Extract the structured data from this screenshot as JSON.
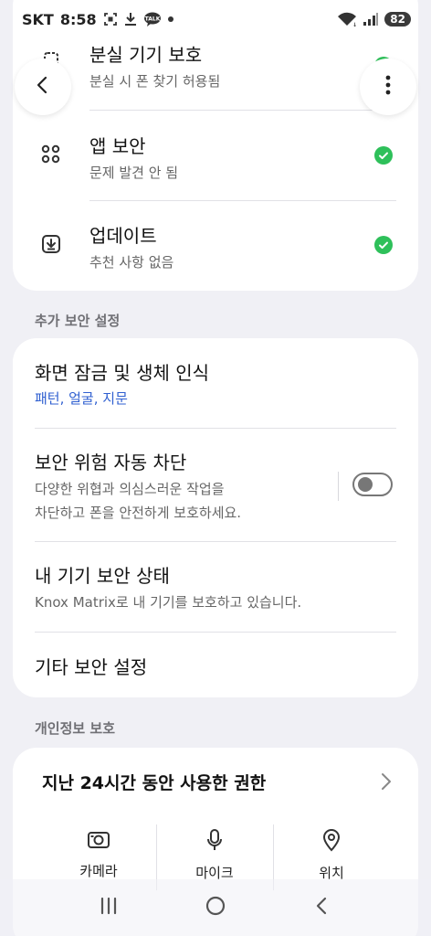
{
  "status_bar": {
    "carrier": "SKT",
    "time": "8:58",
    "battery": "82"
  },
  "card_top": {
    "rows": [
      {
        "title": "분실 기기 보호",
        "subtitle": "분실 시 폰 찾기 허용됨",
        "icon": "lost-device-icon"
      },
      {
        "title": "앱 보안",
        "subtitle": "문제 발견 안 됨",
        "icon": "app-security-icon"
      },
      {
        "title": "업데이트",
        "subtitle": "추천 사항 없음",
        "icon": "update-icon"
      }
    ]
  },
  "extra_security": {
    "header": "추가 보안 설정",
    "items": [
      {
        "title": "화면 잠금 및 생체 인식",
        "subtitle": "패턴, 얼굴, 지문"
      },
      {
        "title": "보안 위험 자동 차단",
        "subtitle_line1": "다양한 위협과 의심스러운 작업을",
        "subtitle_line2": "차단하고 폰을 안전하게 보호하세요.",
        "toggle_on": false
      },
      {
        "title": "내 기기 보안 상태",
        "subtitle": "Knox Matrix로 내 기기를 보호하고 있습니다."
      },
      {
        "title": "기타 보안 설정"
      }
    ]
  },
  "privacy": {
    "header": "개인정보 보호",
    "permissions_title": "지난 24시간 동안 사용한 권한",
    "items": [
      {
        "label": "카메라",
        "icon": "camera-icon"
      },
      {
        "label": "마이크",
        "icon": "microphone-icon"
      },
      {
        "label": "위치",
        "icon": "location-icon"
      }
    ]
  },
  "colors": {
    "accent_blue": "#2f5fd0",
    "check_green": "#2ec05a",
    "background": "#f0f0f5"
  }
}
